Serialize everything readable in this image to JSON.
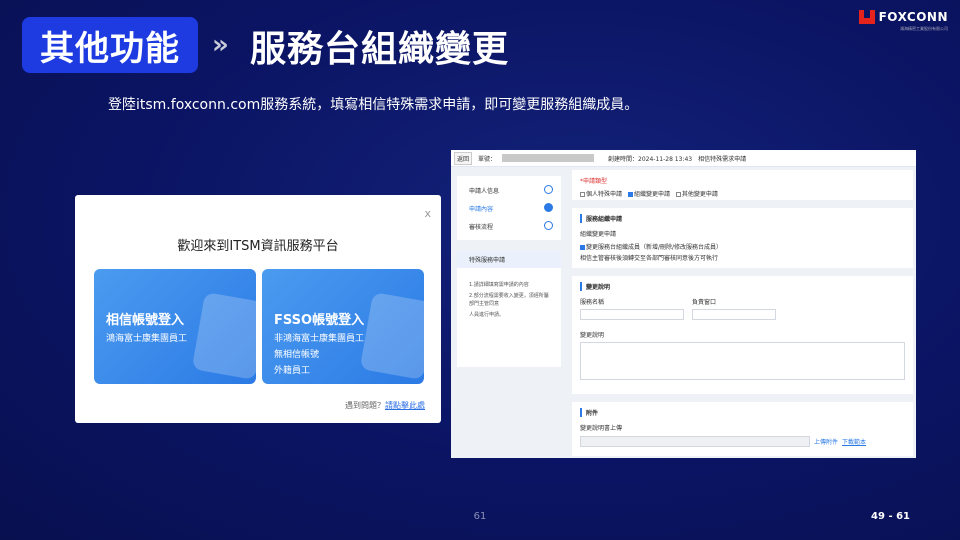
{
  "header": {
    "tag": "其他功能",
    "chevron": "»",
    "title": "服務台組織變更"
  },
  "logo": {
    "name": "FOXCONN",
    "sub": "鴻海精密工業股份有限公司"
  },
  "description": "登陸itsm.foxconn.com服務系統，填寫相信特殊需求申請，即可變更服務組織成員。",
  "dialog": {
    "close": "x",
    "title": "歡迎來到ITSM資訊服務平台",
    "card1": {
      "title": "相信帳號登入",
      "lines": [
        "鴻海富士康集團員工"
      ]
    },
    "card2": {
      "title": "FSSO帳號登入",
      "lines": [
        "非鴻海富士康集團員工",
        "無相信帳號",
        "外籍員工"
      ]
    },
    "help_q": "遇到問題？",
    "help_link": "請點擊此處"
  },
  "form": {
    "top_btn": "返回",
    "top_lbl": "單號：",
    "top_date": "創建時間：2024-11-28 13:43",
    "top_type": "相信特殊需求申請",
    "steps": [
      {
        "label": "申請人信息",
        "state": "todo"
      },
      {
        "label": "申請內容",
        "state": "done"
      },
      {
        "label": "審核流程",
        "state": "todo"
      }
    ],
    "side_title": "特殊服務申請",
    "side_text": [
      "1.請詳細填寫需申請的內容",
      "2.部分流程需要收入變更，須經所屬部門主管同意",
      "人員進行申請。"
    ],
    "req_type_label": "*申請類型",
    "req_types": [
      {
        "label": "個人特殊申請",
        "checked": false
      },
      {
        "label": "組織變更申請",
        "checked": true
      },
      {
        "label": "其他變更申請",
        "checked": false
      }
    ],
    "sec1_title": "服務組織申請",
    "sec1_sub": "組織變更申請",
    "sec1_opt": "變更服務台組織成員（新增/刪除/修改服務台成員）",
    "sec1_more": "相信主管審核後須轉交至各部門審核同意後方可執行",
    "sec2_title": "變更說明",
    "f1_label": "服務名稱",
    "f2_label": "負責窗口",
    "f3_label": "變更說明",
    "sec3_title": "附件",
    "attach_label": "變更說明書上傳",
    "attach_btn": "上傳附件",
    "attach_link": "下載範本"
  },
  "footer": {
    "page": "61",
    "range": "49 - 61"
  }
}
